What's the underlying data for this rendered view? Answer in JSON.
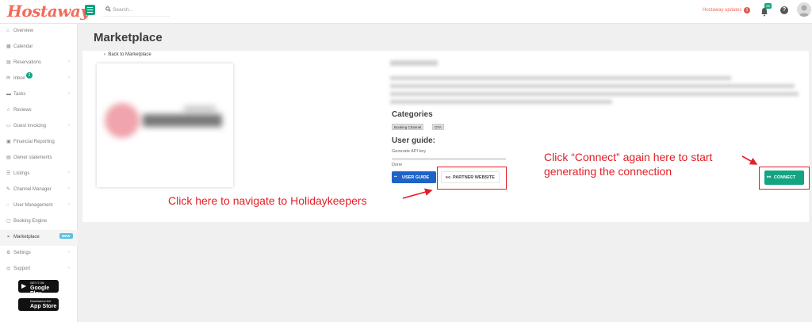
{
  "header": {
    "logo": "Hostaway",
    "search_placeholder": "Search...",
    "updates_label": "Hostaway updates",
    "updates_count": "1",
    "notifications_count": "26",
    "help": "?"
  },
  "sidebar": {
    "items": [
      {
        "label": "Overview",
        "icon": "home-icon"
      },
      {
        "label": "Calendar",
        "icon": "calendar-icon"
      },
      {
        "label": "Reservations",
        "icon": "reservations-icon"
      },
      {
        "label": "Inbox",
        "icon": "inbox-icon",
        "badge": "2"
      },
      {
        "label": "Tasks",
        "icon": "tasks-icon"
      },
      {
        "label": "Reviews",
        "icon": "star-icon"
      },
      {
        "label": "Guest invoicing",
        "icon": "invoice-icon"
      },
      {
        "label": "Financial Reporting",
        "icon": "report-icon"
      },
      {
        "label": "Owner statements",
        "icon": "statement-icon"
      },
      {
        "label": "Listings",
        "icon": "list-icon"
      },
      {
        "label": "Channel Manager",
        "icon": "channel-icon"
      },
      {
        "label": "User Management",
        "icon": "user-icon"
      },
      {
        "label": "Booking Engine",
        "icon": "booking-icon"
      },
      {
        "label": "Marketplace",
        "icon": "marketplace-icon",
        "badge": "NEW"
      },
      {
        "label": "Settings",
        "icon": "gear-icon"
      },
      {
        "label": "Support",
        "icon": "support-icon"
      }
    ],
    "google_play": {
      "small": "GET IT ON",
      "big": "Google Play"
    },
    "app_store": {
      "small": "Download on the",
      "big": "App Store"
    }
  },
  "main": {
    "title": "Marketplace",
    "back_link": "Back to Marketplace",
    "categories_title": "Categories",
    "categories": [
      "Booking Channel",
      "OTA"
    ],
    "user_guide_title": "User guide:",
    "user_guide_steps": [
      "Generate API key",
      "Done"
    ],
    "user_guide_button": "USER GUIDE",
    "partner_button": "PARTNER WEBSITE",
    "connect_button": "CONNECT"
  },
  "annotations": {
    "partner_callout": "Click here to navigate to Holidaykeepers",
    "connect_callout_line1": "Click “Connect” again here to start",
    "connect_callout_line2": "generating the connection",
    "color": "#e21f26"
  },
  "colors": {
    "brand": "#f26b5b",
    "accent": "#13a481",
    "primary_button": "#1f63c6"
  }
}
